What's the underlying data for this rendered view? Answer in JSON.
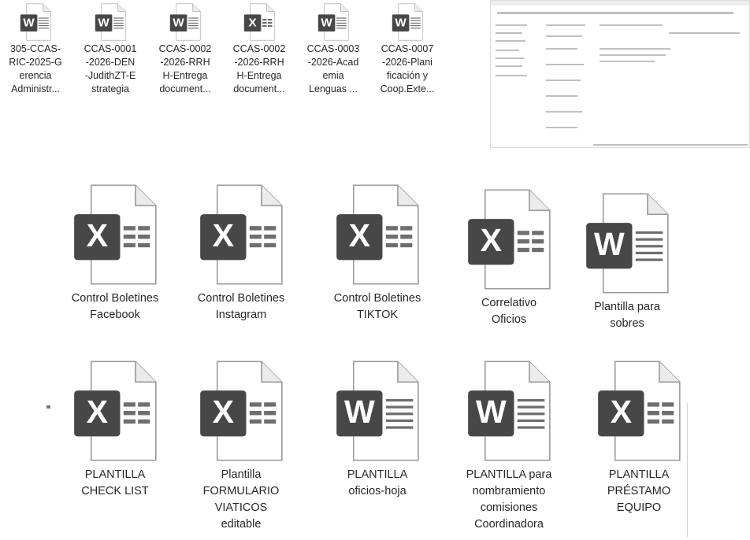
{
  "top_files": [
    {
      "type": "word",
      "letter": "W",
      "label": [
        "305-CCAS-",
        "RIC-2025-G",
        "erencia",
        "Administr..."
      ]
    },
    {
      "type": "word",
      "letter": "W",
      "label": [
        "CCAS-0001",
        "-2026-DEN",
        "-JudithZT-E",
        "strategia"
      ]
    },
    {
      "type": "word",
      "letter": "W",
      "label": [
        "CCAS-0002",
        "-2026-RRH",
        "H-Entrega",
        "document..."
      ]
    },
    {
      "type": "excel",
      "letter": "X",
      "label": [
        "CCAS-0002",
        "-2026-RRH",
        "H-Entrega",
        "document..."
      ]
    },
    {
      "type": "word",
      "letter": "W",
      "label": [
        "CCAS-0003",
        "-2026-Acad",
        "emia",
        "Lenguas ..."
      ]
    },
    {
      "type": "word",
      "letter": "W",
      "label": [
        "CCAS-0007",
        "-2026-Plani",
        "ficación y",
        "Coop.Exte..."
      ]
    }
  ],
  "row1_files": [
    {
      "type": "excel",
      "letter": "X",
      "label": [
        "Control Boletines",
        "Facebook"
      ]
    },
    {
      "type": "excel",
      "letter": "X",
      "label": [
        "Control Boletines",
        "Instagram"
      ]
    },
    {
      "type": "excel",
      "letter": "X",
      "label": [
        "Control Boletines",
        "TIKTOK"
      ]
    },
    {
      "type": "excel",
      "letter": "X",
      "label": [
        "Correlativo",
        "Oficios"
      ]
    },
    {
      "type": "word",
      "letter": "W",
      "label": [
        "Plantilla para",
        "sobres"
      ]
    }
  ],
  "row2_files": [
    {
      "type": "excel",
      "letter": "X",
      "label": [
        "PLANTILLA",
        "CHECK LIST"
      ]
    },
    {
      "type": "excel",
      "letter": "X",
      "label": [
        "Plantilla",
        "FORMULARIO",
        "VIATICOS",
        "editable"
      ]
    },
    {
      "type": "word",
      "letter": "W",
      "label": [
        "PLANTILLA",
        "oficios-hoja"
      ]
    },
    {
      "type": "word",
      "letter": "W",
      "label": [
        "PLANTILLA para",
        "nombramiento",
        "comisiones",
        "Coordinadora"
      ]
    },
    {
      "type": "excel",
      "letter": "X",
      "label": [
        "PLANTILLA",
        "PRÉSTAMO",
        "EQUIPO"
      ]
    }
  ],
  "colors": {
    "badge": "#4a4a4a",
    "page": "#ffffff",
    "fold": "#e6e6e6",
    "outline": "#9a9a9a",
    "lines": "#6f6f6f"
  }
}
